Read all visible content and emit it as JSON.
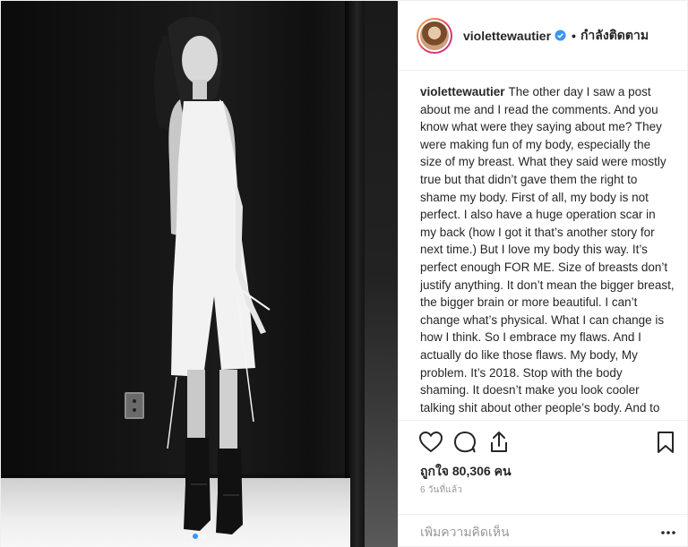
{
  "header": {
    "username": "violettewautier",
    "separator": "•",
    "follow_status": "กำลังติดตาม"
  },
  "caption": {
    "username": "violettewautier",
    "text": "The other day I saw a post about me and I read the comments. And you know what were they saying about me? They were making fun of my body, especially the size of my breast. What they said were mostly true but that didn’t gave them the right to shame my body. First of all, my body is not perfect. I also have a huge operation scar in my back (how I got it that’s another story for next time.) But I love my body this way. It’s perfect enough FOR ME. Size of breasts don’t justify anything. It don’t mean the bigger breast, the bigger brain or more beautiful. I can’t change what’s physical. What I can change is how I think. So I embrace my flaws. And I actually do like those flaws. My body, My problem. It’s 2018. Stop with the body shaming. It doesn’t make you look cooler talking shit about other people’s body. And to all the ladies out there, be proud of your"
  },
  "actions": {
    "icons": [
      "heart-icon",
      "comment-icon",
      "share-icon",
      "bookmark-icon"
    ]
  },
  "likes": {
    "text": "ถูกใจ 80,306 คน"
  },
  "timestamp": "6 วันที่แล้ว",
  "comment": {
    "placeholder": "เพิ่มความคิดเห็น"
  },
  "carousel": {
    "total": 2,
    "active": 1
  },
  "colors": {
    "accent": "#3897f0",
    "text": "#262626",
    "muted": "#999999",
    "border": "#efefef"
  }
}
